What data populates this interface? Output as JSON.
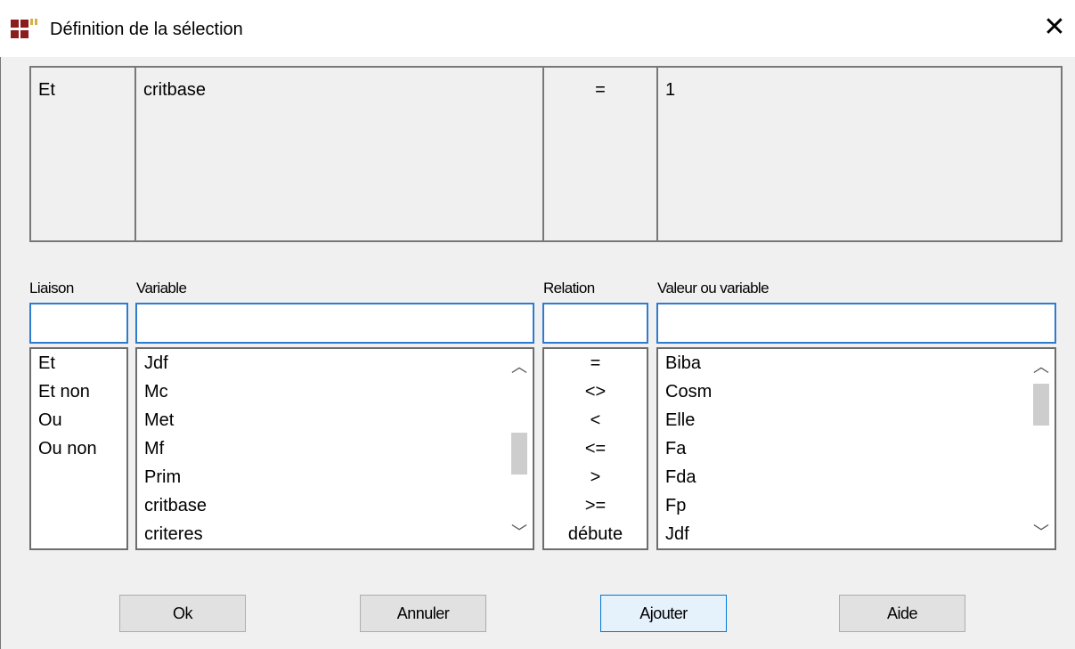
{
  "window": {
    "title": "Définition de la sélection",
    "close_glyph": "✕"
  },
  "summary": {
    "liaison": "Et",
    "variable": "critbase",
    "relation": "=",
    "valeur": "1"
  },
  "columns": {
    "liaison": "Liaison",
    "variable": "Variable",
    "relation": "Relation",
    "valeur": "Valeur ou variable"
  },
  "inputs": {
    "liaison": "",
    "variable": "",
    "relation": "",
    "valeur": ""
  },
  "lists": {
    "liaison": [
      "Et",
      "Et non",
      "Ou",
      "Ou non"
    ],
    "variable": [
      "Jdf",
      "Mc",
      "Met",
      "Mf",
      "Prim",
      "critbase",
      "criteres"
    ],
    "relation": [
      "=",
      "<>",
      "<",
      "<=",
      ">",
      ">=",
      "débute"
    ],
    "valeur": [
      "Biba",
      "Cosm",
      "Elle",
      "Fa",
      "Fda",
      "Fp",
      "Jdf"
    ]
  },
  "scroll": {
    "variable": {
      "position": 0.55,
      "visible_fraction": 0.3
    },
    "valeur": {
      "position": 0.05,
      "visible_fraction": 0.3
    }
  },
  "buttons": {
    "ok": "Ok",
    "cancel": "Annuler",
    "add": "Ajouter",
    "help": "Aide"
  },
  "colors": {
    "accent": "#0078d7",
    "icon_red": "#8b1d1d",
    "icon_gold": "#d3b14a"
  }
}
